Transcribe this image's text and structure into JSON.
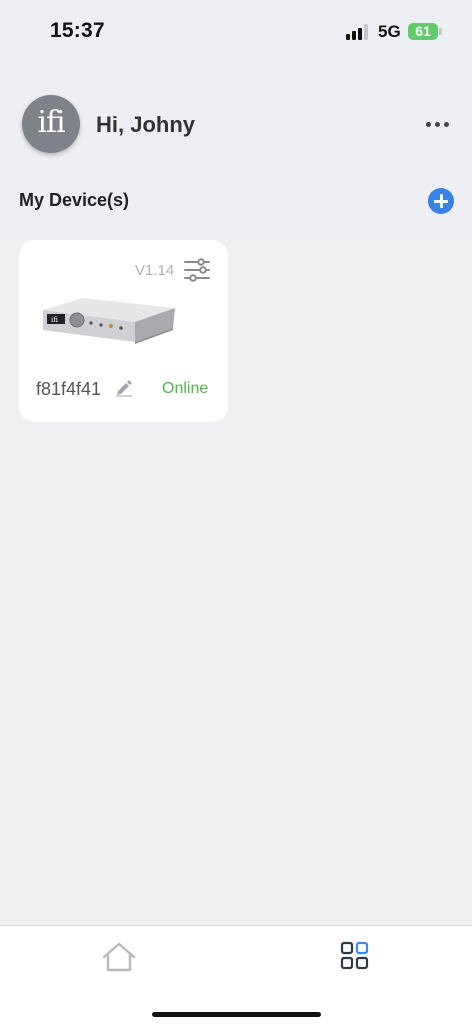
{
  "status_bar": {
    "time": "15:37",
    "network": "5G",
    "battery": "61",
    "battery_color": "#5fcb6a"
  },
  "header": {
    "avatar_text": "ifi",
    "greeting": "Hi, Johny",
    "more_icon": "more-horizontal-icon"
  },
  "section": {
    "title": "My Device(s)",
    "add_icon": "plus-circle-icon",
    "accent_color": "#3b82e6"
  },
  "devices": [
    {
      "firmware": "V1.14",
      "id": "f81f4f41",
      "status": "Online",
      "status_color": "#4cb848",
      "settings_icon": "sliders-icon",
      "edit_icon": "pencil-icon"
    }
  ],
  "tab_bar": {
    "tabs": [
      {
        "icon": "home-icon",
        "active": false
      },
      {
        "icon": "grid-icon",
        "active": true
      }
    ]
  }
}
